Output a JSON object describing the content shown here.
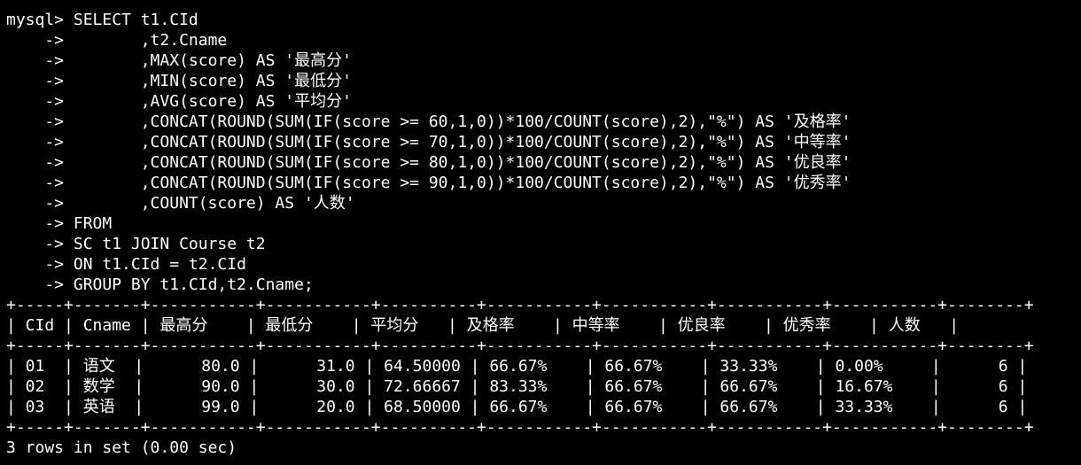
{
  "lines": [
    "mysql> SELECT t1.CId",
    "    ->        ,t2.Cname",
    "    ->        ,MAX(score) AS '最高分'",
    "    ->        ,MIN(score) AS '最低分'",
    "    ->        ,AVG(score) AS '平均分'",
    "    ->        ,CONCAT(ROUND(SUM(IF(score >= 60,1,0))*100/COUNT(score),2),\"%\") AS '及格率'",
    "    ->        ,CONCAT(ROUND(SUM(IF(score >= 70,1,0))*100/COUNT(score),2),\"%\") AS '中等率'",
    "    ->        ,CONCAT(ROUND(SUM(IF(score >= 80,1,0))*100/COUNT(score),2),\"%\") AS '优良率'",
    "    ->        ,CONCAT(ROUND(SUM(IF(score >= 90,1,0))*100/COUNT(score),2),\"%\") AS '优秀率'",
    "    ->        ,COUNT(score) AS '人数'",
    "    -> FROM",
    "    -> SC t1 JOIN Course t2",
    "    -> ON t1.CId = t2.CId",
    "    -> GROUP BY t1.CId,t2.Cname;",
    "+-----+-------+-----------+-----------+----------+-----------+-----------+-----------+-----------+--------+",
    "| CId | Cname | 最高分    | 最低分    | 平均分   | 及格率    | 中等率    | 优良率    | 优秀率    | 人数   |",
    "+-----+-------+-----------+-----------+----------+-----------+-----------+-----------+-----------+--------+",
    "| 01  | 语文  |      80.0 |      31.0 | 64.50000 | 66.67%    | 66.67%    | 33.33%    | 0.00%     |      6 |",
    "| 02  | 数学  |      90.0 |      30.0 | 72.66667 | 83.33%    | 66.67%    | 66.67%    | 16.67%    |      6 |",
    "| 03  | 英语  |      99.0 |      20.0 | 68.50000 | 66.67%    | 66.67%    | 66.67%    | 33.33%    |      6 |",
    "+-----+-------+-----------+-----------+----------+-----------+-----------+-----------+-----------+--------+",
    "3 rows in set (0.00 sec)"
  ]
}
